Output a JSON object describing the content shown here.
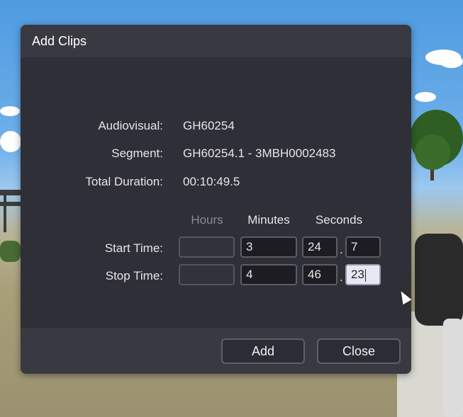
{
  "dialog": {
    "title": "Add Clips",
    "info": [
      {
        "label": "Audiovisual:",
        "value": "GH60254"
      },
      {
        "label": "Segment:",
        "value": "GH60254.1 - 3MBH0002483"
      },
      {
        "label": "Total Duration:",
        "value": "00:10:49.5"
      }
    ],
    "columns": {
      "hours": "Hours",
      "minutes": "Minutes",
      "seconds": "Seconds"
    },
    "start": {
      "label": "Start Time:",
      "hours": "",
      "minutes": "3",
      "seconds": "24",
      "fraction": "7"
    },
    "stop": {
      "label": "Stop Time:",
      "hours": "",
      "minutes": "4",
      "seconds": "46",
      "fraction": "23"
    },
    "separator": ".",
    "buttons": {
      "add": "Add",
      "close": "Close"
    }
  },
  "colors": {
    "dialog_bg": "#2f2f38",
    "titlebar_bg": "#393942",
    "disabled_header": "#8a8a93",
    "focused_field": "#e8e8f4"
  }
}
